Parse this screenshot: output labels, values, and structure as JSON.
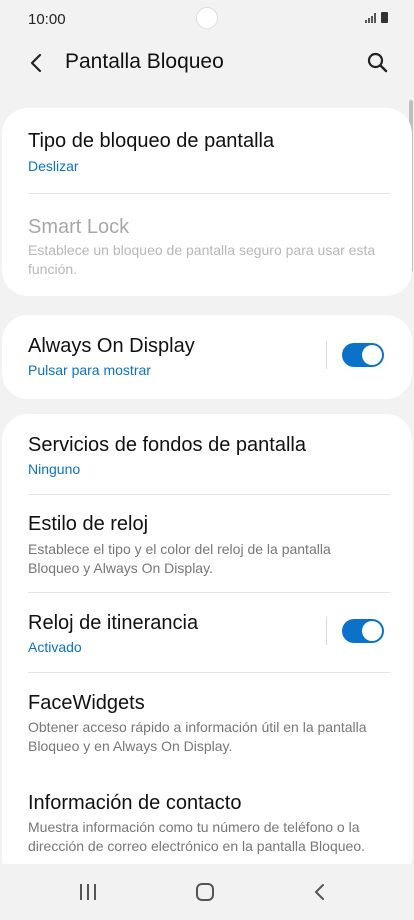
{
  "status_bar": {
    "time": "10:00"
  },
  "header": {
    "title": "Pantalla Bloqueo"
  },
  "card1": {
    "lock_type": {
      "title": "Tipo de bloqueo de pantalla",
      "value": "Deslizar"
    },
    "smart_lock": {
      "title": "Smart Lock",
      "desc": "Establece un bloqueo de pantalla seguro para usar esta función."
    }
  },
  "card2": {
    "aod": {
      "title": "Always On Display",
      "value": "Pulsar para mostrar",
      "enabled": true
    }
  },
  "card3": {
    "wallpaper": {
      "title": "Servicios de fondos de pantalla",
      "value": "Ninguno"
    },
    "clock_style": {
      "title": "Estilo de reloj",
      "desc": "Establece el tipo y el color del reloj de la pantalla Bloqueo y Always On Display."
    },
    "roaming": {
      "title": "Reloj de itinerancia",
      "value": "Activado",
      "enabled": true
    },
    "facewidgets": {
      "title": "FaceWidgets",
      "desc": "Obtener acceso rápido a información útil en la pantalla Bloqueo y en Always On Display."
    },
    "contact": {
      "title": "Información de contacto",
      "desc": "Muestra información como tu número de teléfono o la dirección de correo electrónico en la pantalla Bloqueo."
    }
  },
  "colors": {
    "accent": "#0b72c9",
    "background": "#f2f2f2"
  }
}
